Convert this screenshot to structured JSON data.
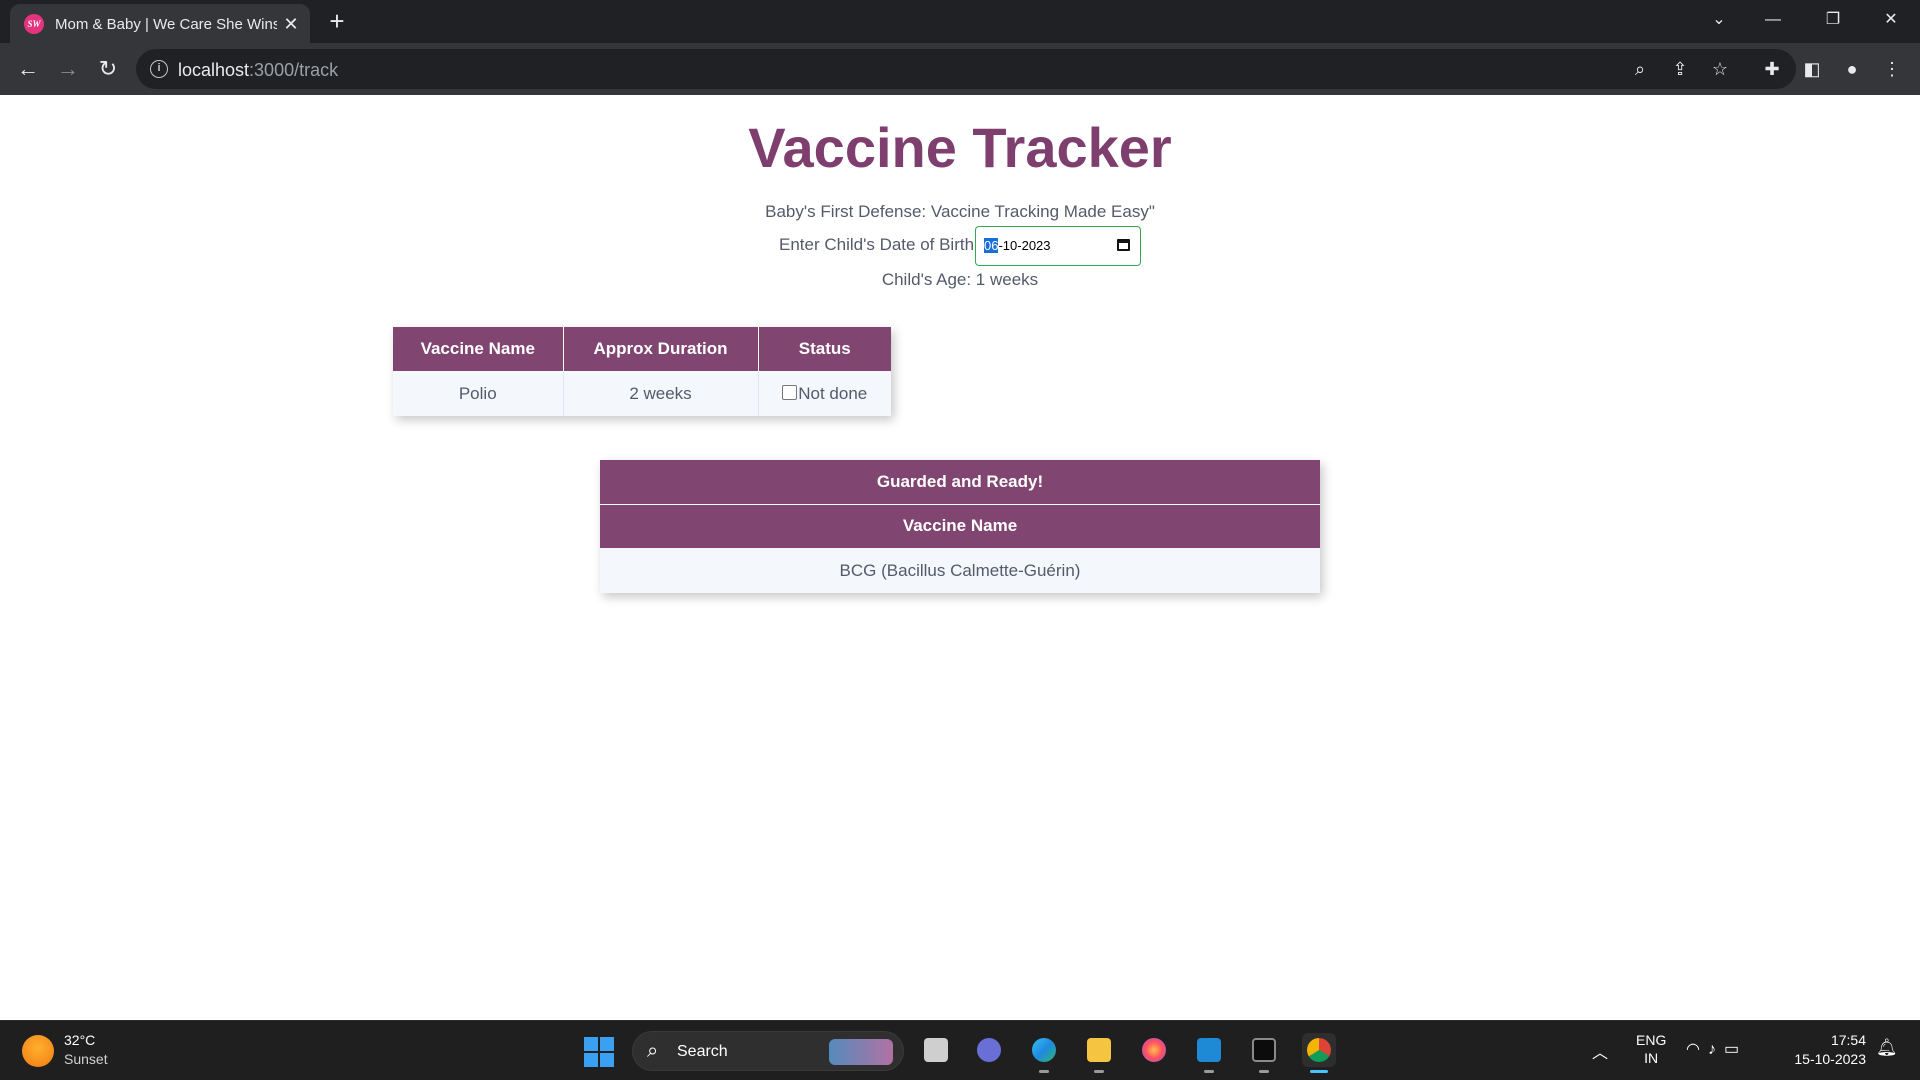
{
  "browser": {
    "tab_title": "Mom & Baby | We Care She Wins",
    "favicon_text": "SW",
    "url_host": "localhost",
    "url_path": ":3000/track"
  },
  "page": {
    "title": "Vaccine Tracker",
    "tagline": "Baby's First Defense: Vaccine Tracking Made Easy\"",
    "dob_label": "Enter Child's Date of Birth:",
    "dob_day": "06",
    "dob_rest": "-10-2023",
    "age_line": "Child's Age: 1 weeks",
    "pending_table": {
      "headers": [
        "Vaccine Name",
        "Approx Duration",
        "Status"
      ],
      "rows": [
        {
          "name": "Polio",
          "duration": "2 weeks",
          "status": "Not done"
        }
      ]
    },
    "done_table": {
      "caption": "Guarded and Ready!",
      "header": "Vaccine Name",
      "rows": [
        {
          "name": "BCG (Bacillus Calmette-Guérin)"
        }
      ]
    }
  },
  "taskbar": {
    "weather_temp": "32°C",
    "weather_cond": "Sunset",
    "search_label": "Search",
    "lang_line1": "ENG",
    "lang_line2": "IN",
    "time": "17:54",
    "date": "15-10-2023"
  },
  "colors": {
    "accent": "#804570",
    "title": "#7e3f6f",
    "input_focus": "#35a853"
  }
}
